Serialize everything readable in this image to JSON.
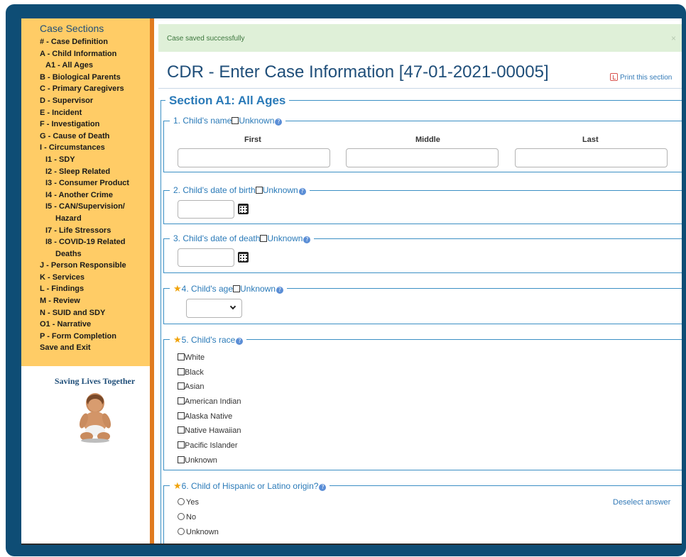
{
  "sidebar": {
    "title": "Case Sections",
    "items": [
      {
        "label": "# - Case Definition",
        "level": 1
      },
      {
        "label": "A - Child Information",
        "level": 1
      },
      {
        "label": "A1 - All Ages",
        "level": 2
      },
      {
        "label": "B - Biological Parents",
        "level": 1
      },
      {
        "label": "C - Primary Caregivers",
        "level": 1
      },
      {
        "label": "D - Supervisor",
        "level": 1
      },
      {
        "label": "E - Incident",
        "level": 1
      },
      {
        "label": "F - Investigation",
        "level": 1
      },
      {
        "label": "G - Cause of Death",
        "level": 1
      },
      {
        "label": "I - Circumstances",
        "level": 1
      },
      {
        "label": "I1 - SDY",
        "level": 2
      },
      {
        "label": "I2 - Sleep Related",
        "level": 2
      },
      {
        "label": "I3 - Consumer Product",
        "level": 2
      },
      {
        "label": "I4 - Another Crime",
        "level": 2
      },
      {
        "label": "I5 - CAN/Supervision/",
        "cont": "Hazard",
        "level": 2
      },
      {
        "label": "I7 - Life Stressors",
        "level": 2
      },
      {
        "label": "I8 - COVID-19 Related",
        "cont": "Deaths",
        "level": 2
      },
      {
        "label": "J - Person Responsible",
        "level": 1
      },
      {
        "label": "K - Services",
        "level": 1
      },
      {
        "label": "L - Findings",
        "level": 1
      },
      {
        "label": "M - Review",
        "level": 1
      },
      {
        "label": "N - SUID and SDY",
        "level": 1
      },
      {
        "label": "O1 - Narrative",
        "level": 1
      },
      {
        "label": "P - Form Completion",
        "level": 1
      },
      {
        "label": "Save and Exit",
        "level": 1
      }
    ],
    "brand": "Saving Lives Together"
  },
  "alert": {
    "message": "Case saved successfully",
    "close": "×"
  },
  "page": {
    "title": "CDR - Enter Case Information [47-01-2021-00005]",
    "print_link": "Print this section"
  },
  "section": {
    "title": "Section A1: All Ages",
    "q1": {
      "label": "1. Child's name",
      "unknown": "Unknown",
      "cols": [
        "First",
        "Middle",
        "Last"
      ]
    },
    "q2": {
      "label": "2. Child's date of birth",
      "unknown": "Unknown"
    },
    "q3": {
      "label": "3. Child's date of death",
      "unknown": "Unknown"
    },
    "q4": {
      "label": "4. Child's age",
      "unknown": "Unknown"
    },
    "q5": {
      "label": "5. Child's race",
      "options": [
        "White",
        "Black",
        "Asian",
        "American Indian",
        "Alaska Native",
        "Native Hawaiian",
        "Pacific Islander",
        "Unknown"
      ]
    },
    "q6": {
      "label": "6. Child of Hispanic or Latino origin?",
      "options": [
        "Yes",
        "No",
        "Unknown"
      ],
      "deselect": "Deselect answer"
    }
  },
  "icons": {
    "required": "star-icon",
    "help": "help-icon",
    "calendar": "calendar-icon",
    "pdf": "pdf-icon"
  },
  "colors": {
    "frame": "#0e4d75",
    "sidebar": "#ffcc66",
    "sidebar_divider": "#e07a1f",
    "heading": "#1f4e79",
    "section_accent": "#2a7ab8",
    "alert_bg": "#dff0d8"
  }
}
